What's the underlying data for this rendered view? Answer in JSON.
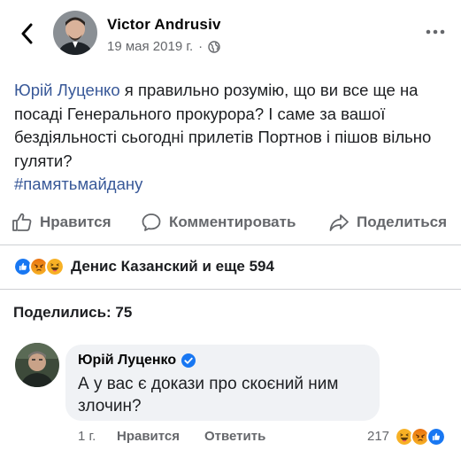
{
  "post": {
    "author": "Victor Andrusiv",
    "date": "19 мая 2019 г.",
    "meta_separator": "·",
    "mention": "Юрій Луценко",
    "body": " я правильно розумію, що ви все ще на посаді Генерального прокурора? І саме за вашої бездіяльності сьогодні прилетів Портнов і пішов вільно гуляти?",
    "hashtag": "#памятьмайдану"
  },
  "actions": {
    "like_label": "Нравится",
    "comment_label": "Комментировать",
    "share_label": "Поделиться"
  },
  "reactions": {
    "summary": "Денис Казанский и еще 594",
    "icons": [
      "like-icon",
      "angry-icon",
      "haha-icon"
    ]
  },
  "shares": {
    "label": "Поделились: 75"
  },
  "comment": {
    "author": "Юрій Луценко",
    "verified": true,
    "text": "А у вас є докази про скоєний ним злочин?",
    "time": "1 г.",
    "like_label": "Нравится",
    "reply_label": "Ответить",
    "reaction_count": "217",
    "reaction_icons": [
      "haha-icon",
      "angry-icon",
      "like-icon"
    ]
  },
  "colors": {
    "link": "#385898",
    "secondary_text": "#65676b",
    "like_blue": "#1877f2",
    "reaction_yellow": "#f7b125",
    "reaction_red": "#e9710f",
    "bubble_bg": "#f0f2f5"
  }
}
